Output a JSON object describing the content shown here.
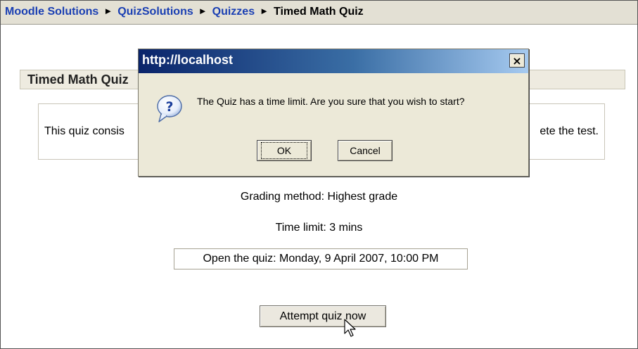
{
  "breadcrumb": {
    "items": [
      "Moodle Solutions",
      "QuizSolutions",
      "Quizzes"
    ],
    "current": "Timed Math Quiz",
    "separator": "►"
  },
  "quiz": {
    "heading": "Timed Math Quiz",
    "intro_left": "This quiz consis",
    "intro_right": "ete the test.",
    "grading_method": "Grading method: Highest grade",
    "time_limit": "Time limit: 3 mins",
    "open_date": "Open the quiz: Monday, 9 April 2007, 10:00 PM",
    "attempt_label": "Attempt quiz now"
  },
  "dialog": {
    "title": "http://localhost",
    "close_label": "×",
    "message": "The Quiz has a time limit. Are you sure that you wish to start?",
    "ok_label": "OK",
    "cancel_label": "Cancel",
    "icon": "question-icon"
  },
  "colors": {
    "link": "#1a3fb3",
    "navbar_bg": "#e3e0d4",
    "titlebar_start": "#0a246a",
    "titlebar_end": "#a6caf0",
    "dialog_bg": "#ece9d8"
  }
}
